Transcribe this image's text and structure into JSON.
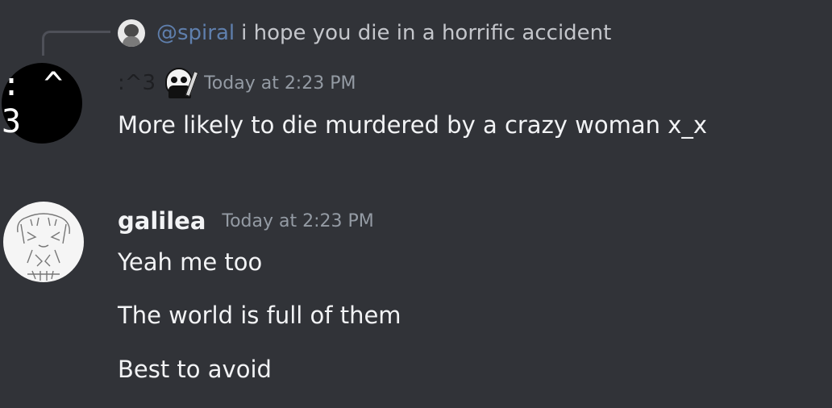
{
  "reply": {
    "mention": "@spiral",
    "text": "i hope you die in a horrific accident"
  },
  "messages": [
    {
      "avatar_text": ": ^ 3",
      "author": ":^3",
      "role_icon": "grim-reaper-icon",
      "timestamp": "Today at 2:23 PM",
      "lines": [
        "More likely to die murdered by a crazy woman x_x"
      ]
    },
    {
      "author": "galilea",
      "timestamp": "Today at 2:23 PM",
      "lines": [
        "Yeah me too",
        "The world is full of them",
        "Best to avoid"
      ]
    }
  ],
  "colors": {
    "background": "#313338",
    "mention": "#5f7fad",
    "timestamp": "#949ba4",
    "text": "#f2f3f5"
  }
}
